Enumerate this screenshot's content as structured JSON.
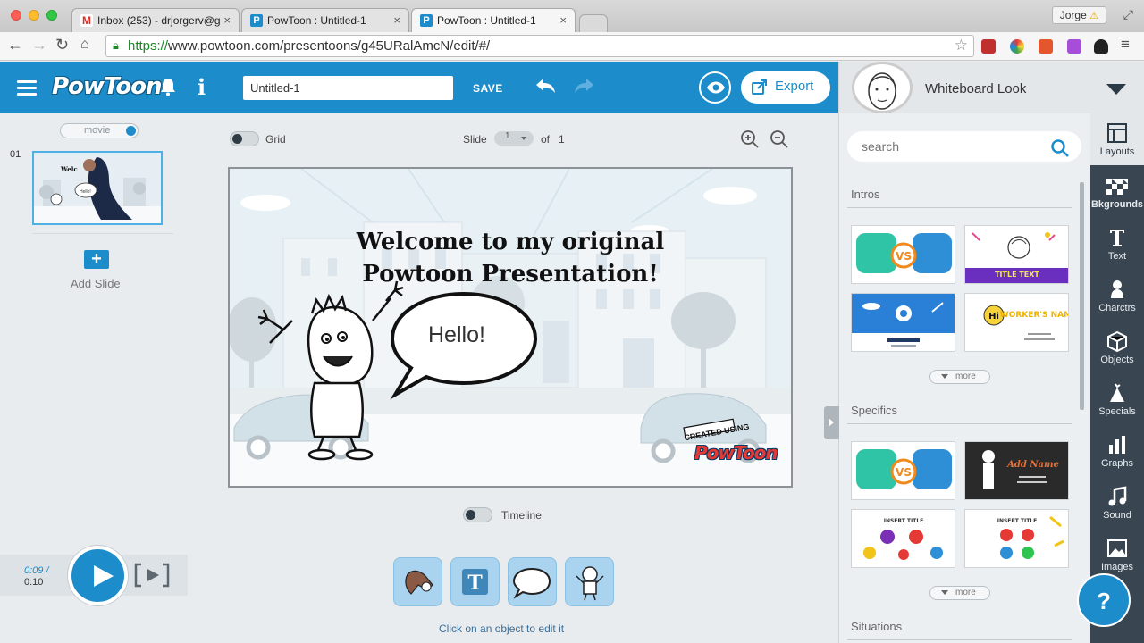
{
  "browser": {
    "tabs": [
      {
        "title": "Inbox (253) - drjorgerv@g",
        "favicon": "gmail-icon"
      },
      {
        "title": "PowToon : Untitled-1",
        "favicon": "powtoon-icon"
      },
      {
        "title": "PowToon : Untitled-1",
        "favicon": "powtoon-icon"
      }
    ],
    "user": "Jorge",
    "url_scheme": "https://",
    "url_rest": "www.powtoon.com/presentoons/g45URalAmcN/edit/#/"
  },
  "header": {
    "logo": "PowToon",
    "title_value": "Untitled-1",
    "save_label": "SAVE",
    "export_label": "Export"
  },
  "style_selector": {
    "label": "Whiteboard Look"
  },
  "left_panel": {
    "mode_label": "movie",
    "slide_number": "01",
    "add_slide_label": "Add Slide"
  },
  "canvas_toolbar": {
    "grid_label": "Grid",
    "slide_label": "Slide",
    "slide_current": "1",
    "of_label": "of",
    "slide_total": "1"
  },
  "slide": {
    "title_line1": "Welcome to my original",
    "title_line2": "Powtoon Presentation!",
    "bubble_text": "Hello!",
    "watermark_top": "CREATED USING",
    "watermark_logo": "PowToon"
  },
  "timeline_label": "Timeline",
  "edit_hint": "Click on an object to edit it",
  "player": {
    "current_time": "0:09 /",
    "total_time": "0:10"
  },
  "library": {
    "search_placeholder": "search",
    "sections": [
      {
        "title": "Intros",
        "more_label": "more"
      },
      {
        "title": "Specifics",
        "more_label": "more"
      },
      {
        "title": "Situations"
      }
    ],
    "tpl_texts": {
      "title_text": "TITLE TEXT",
      "workers_name": "WORKER'S NAME",
      "add_name": "Add Name",
      "insert_title": "INSERT TITLE",
      "vs": "VS"
    }
  },
  "rail": [
    {
      "label": "Layouts",
      "icon": "layouts-icon"
    },
    {
      "label": "Bkgrounds",
      "icon": "backgrounds-icon"
    },
    {
      "label": "Text",
      "icon": "text-icon"
    },
    {
      "label": "Charctrs",
      "icon": "characters-icon"
    },
    {
      "label": "Objects",
      "icon": "objects-icon"
    },
    {
      "label": "Specials",
      "icon": "specials-icon"
    },
    {
      "label": "Graphs",
      "icon": "graphs-icon"
    },
    {
      "label": "Sound",
      "icon": "sound-icon"
    },
    {
      "label": "Images",
      "icon": "images-icon"
    }
  ],
  "help_label": "?",
  "colors": {
    "brand": "#1d8ccb",
    "rail": "#394652",
    "accent_purple": "#6b2fbf"
  }
}
